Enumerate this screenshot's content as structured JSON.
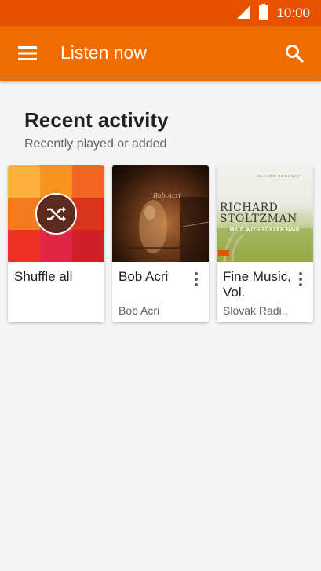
{
  "status_bar": {
    "time": "10:00"
  },
  "app_bar": {
    "title": "Listen now"
  },
  "section": {
    "title": "Recent activity",
    "subtitle": "Recently played or added"
  },
  "cards": [
    {
      "title": "Shuffle all",
      "subtitle": ""
    },
    {
      "title": "Bob Acri",
      "subtitle": "Bob Acri",
      "art_text": "Bob Acri"
    },
    {
      "title": "Fine Music, Vol.",
      "subtitle": "Slovak Radi..",
      "art_top": "CLAUDE DEBUSSY",
      "art_name1": "RICHARD",
      "art_name2": "STOLTZMAN",
      "art_tagline": "MAID WITH FLAXEN HAIR"
    }
  ],
  "colors": {
    "status_bar": "#e65100",
    "app_bar": "#ef6c00",
    "background": "#f5f5f5",
    "mosaic": [
      "#fbb040",
      "#f7941d",
      "#f26522",
      "#f47b20",
      "#e8521d",
      "#d9341c",
      "#ee3124",
      "#e02546",
      "#cf2027"
    ]
  },
  "icons": [
    "menu-icon",
    "search-icon",
    "shuffle-icon",
    "signal-icon",
    "battery-icon",
    "more-vert-icon"
  ]
}
